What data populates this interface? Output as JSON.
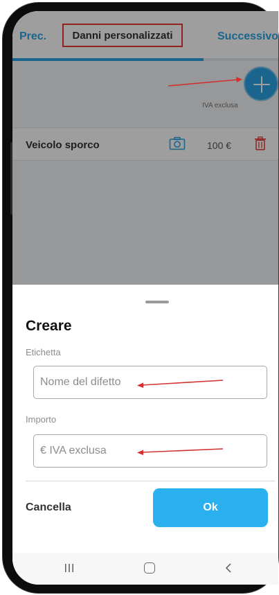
{
  "navbar": {
    "prev_label": "Prec.",
    "title": "Danni personalizzati",
    "next_label": "Successivo",
    "progress": 0.72
  },
  "list": {
    "column_header": "IVA exclusa",
    "items": [
      {
        "label": "Veicolo sporco",
        "amount": "100 €"
      }
    ]
  },
  "sheet": {
    "title": "Creare",
    "label_field": {
      "label": "Etichetta",
      "placeholder": "Nome del difetto",
      "value": ""
    },
    "amount_field": {
      "label": "Importo",
      "placeholder": "€ IVA exclusa",
      "value": ""
    },
    "cancel_label": "Cancella",
    "ok_label": "Ok"
  },
  "icons": {
    "add": "plus-icon",
    "photo": "camera-icon",
    "delete": "trash-icon",
    "recents": "recents-icon",
    "home": "home-icon",
    "back": "back-icon"
  },
  "colors": {
    "accent": "#2aa3e6",
    "ok_button": "#2ab0ef",
    "delete": "#e53935",
    "annotation": "#d32f2f"
  }
}
